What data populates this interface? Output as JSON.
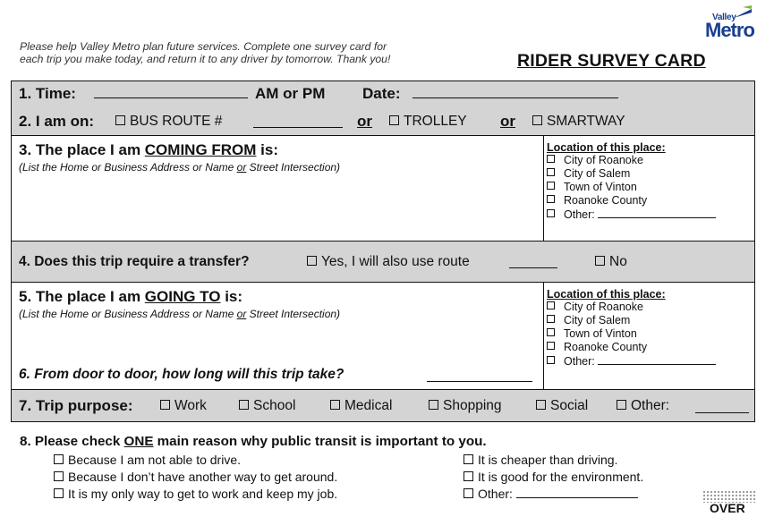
{
  "logo": {
    "top": "Valley",
    "bottom": "Metro"
  },
  "intro": {
    "line1": "Please help Valley Metro plan future services. Complete one survey card for",
    "line2": "each trip you make today, and return it to any driver by tomorrow. Thank you!"
  },
  "title": "RIDER SURVEY CARD",
  "q1": {
    "label": "1. Time:",
    "ampm": "AM or PM",
    "date": "Date:"
  },
  "q2": {
    "label": "2. I am on:",
    "bus": "BUS ROUTE #",
    "or": "or",
    "trolley": "TROLLEY",
    "smartway": "SMARTWAY"
  },
  "q3": {
    "label_pre": "3. The place I am ",
    "label_ul": "COMING FROM",
    "label_post": " is:",
    "hint_pre": "(List the Home or Business Address or Name ",
    "hint_or": "or",
    "hint_post": " Street Intersection)"
  },
  "location": {
    "title": "Location of this place:",
    "options": [
      "City of Roanoke",
      "City of Salem",
      "Town of Vinton",
      "Roanoke County",
      "Other:"
    ]
  },
  "q4": {
    "label": "4. Does this trip require a transfer?",
    "yes": "Yes, I will also use route",
    "no": "No"
  },
  "q5": {
    "label_pre": "5. The place I am ",
    "label_ul": "GOING TO",
    "label_post": " is:",
    "hint_pre": "(List the Home or Business Address or Name ",
    "hint_or": "or",
    "hint_post": " Street Intersection)"
  },
  "q6": {
    "label": "6. From door to door, how long will this trip take?"
  },
  "q7": {
    "label": "7. Trip purpose:",
    "options": [
      "Work",
      "School",
      "Medical",
      "Shopping",
      "Social",
      "Other:"
    ]
  },
  "q8": {
    "label_pre": "8. Please check ",
    "label_ul": "ONE",
    "label_post": " main reason why public transit is important to you.",
    "left": [
      "Because I am not able to drive.",
      "Because I don’t have another way to get around.",
      "It is my only way to get to work and keep my job."
    ],
    "right": [
      "It is cheaper than driving.",
      "It is good for the environment.",
      "Other:"
    ]
  },
  "over": "OVER"
}
